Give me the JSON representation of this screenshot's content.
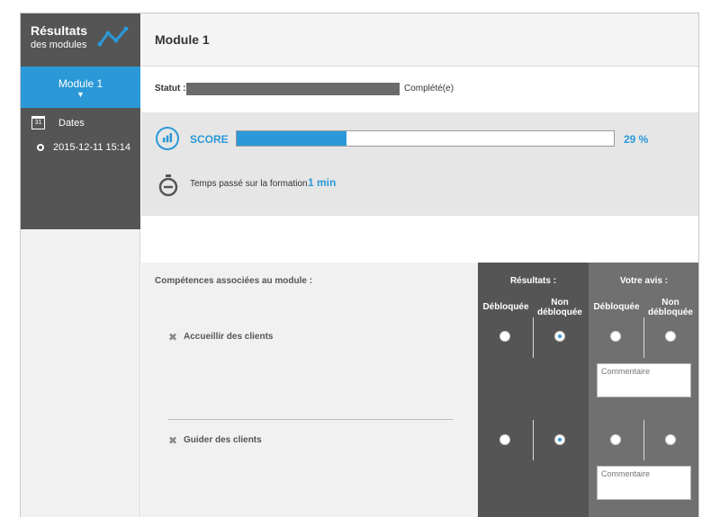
{
  "sidebar": {
    "brand_title": "Résultats",
    "brand_subtitle": "des modules",
    "module_tab": "Module 1",
    "dates_label": "Dates",
    "calendar_day": "31",
    "date_entry": "2015-12-11 15:14"
  },
  "main": {
    "title": "Module 1",
    "statut_label": "Statut :",
    "statut_value": "Complété(e)",
    "score_label": "SCORE",
    "score_percent": 29,
    "score_text": "29 %",
    "temps_label": "Temps passé sur la formation :",
    "temps_value": "1 min"
  },
  "competences": {
    "title": "Compétences associées au module :",
    "items": [
      {
        "label": "Accueillir des clients",
        "resultat": "non_debloquee"
      },
      {
        "label": "Guider des clients",
        "resultat": "non_debloquee"
      }
    ]
  },
  "resultats": {
    "title": "Résultats :",
    "debloquee": "Débloquée",
    "non_debloquee": "Non débloquée"
  },
  "avis": {
    "title": "Votre avis :",
    "debloquee": "Débloquée",
    "non_debloquee": "Non débloquée",
    "comment_placeholder": "Commentaire"
  },
  "colors": {
    "accent": "#2b99d8",
    "dark_panel": "#555555",
    "mid_panel": "#707070"
  }
}
